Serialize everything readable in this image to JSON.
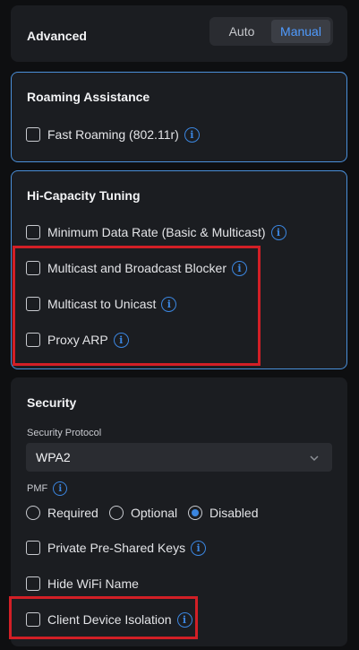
{
  "advanced": {
    "title": "Advanced",
    "mode_options": [
      "Auto",
      "Manual"
    ],
    "selected_mode": "Manual"
  },
  "roaming": {
    "title": "Roaming Assistance",
    "fast_roaming": "Fast Roaming (802.11r)"
  },
  "hicap": {
    "title": "Hi-Capacity Tuning",
    "min_data_rate": "Minimum Data Rate (Basic & Multicast)",
    "mc_bc_blocker": "Multicast and Broadcast Blocker",
    "mc_to_unicast": "Multicast to Unicast",
    "proxy_arp": "Proxy ARP"
  },
  "security": {
    "title": "Security",
    "protocol_label": "Security Protocol",
    "protocol_value": "WPA2",
    "pmf_label": "PMF",
    "pmf_options": [
      "Required",
      "Optional",
      "Disabled"
    ],
    "pmf_selected": "Disabled",
    "ppsk": "Private Pre-Shared Keys",
    "hide_wifi": "Hide WiFi Name",
    "client_isolation": "Client Device Isolation"
  },
  "icons": {
    "info": "i",
    "chevron": "chevron-down-icon"
  },
  "colors": {
    "accent": "#3b86e0",
    "highlight": "#d21f26",
    "panel": "#1b1d21",
    "background": "#0e0f11"
  }
}
